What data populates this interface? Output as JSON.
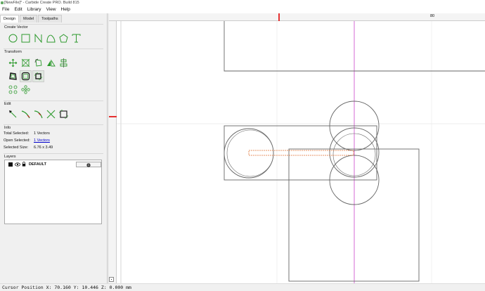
{
  "window": {
    "title": "[NewFile]* - Carbide Create PRO. Build 815"
  },
  "menu": {
    "items": [
      "File",
      "Edit",
      "Library",
      "View",
      "Help"
    ]
  },
  "tabs": [
    "Design",
    "Model",
    "Toolpaths"
  ],
  "sections": {
    "create_vector": "Create Vector",
    "transform": "Transform",
    "edit": "Edit",
    "info": "Info",
    "layers": "Layers"
  },
  "info": {
    "total_label": "Total Selected:",
    "total_value": "1 Vectors",
    "open_label": "Open Selected:",
    "open_value": "1 Vectors",
    "size_label": "Selected Size:",
    "size_value": "6.76 x 3.49"
  },
  "layers": {
    "name": "DEFAULT",
    "settings_icon": "gear-icon"
  },
  "ruler": {
    "top_label": "80"
  },
  "status": {
    "cursor": "Cursor Position X: 70.160 Y: 10.446 Z: 0.000 mm"
  },
  "colors": {
    "vector_green": "#2e9a2e",
    "selection_orange": "#e07030",
    "guide_magenta": "#cc44cc",
    "ruler_marker": "#e53030"
  },
  "icons": {
    "create_vector": [
      "circle-tool-icon",
      "rectangle-tool-icon",
      "polyline-tool-icon",
      "curve-tool-icon",
      "polygon-tool-icon",
      "text-tool-icon"
    ],
    "transform_row1": [
      "move-icon",
      "scale-icon",
      "rotate-icon",
      "mirror-icon",
      "align-icon"
    ],
    "transform_row2": [
      "offset-icon",
      "round-corner-icon",
      "join-icon"
    ],
    "transform_row3": [
      "array-icon",
      "circular-array-icon"
    ],
    "edit": [
      "node-edit-icon",
      "trim-icon",
      "fillet-icon",
      "cut-icon",
      "boolean-icon"
    ]
  }
}
